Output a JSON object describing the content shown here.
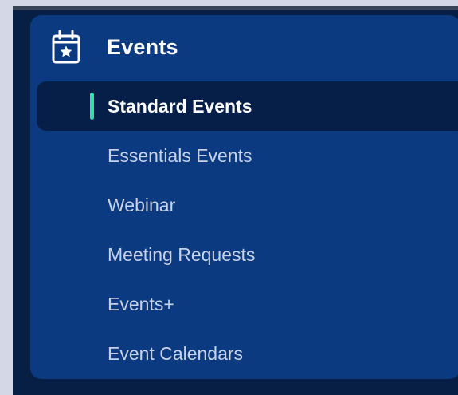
{
  "section": {
    "title": "Events",
    "icon": "calendar-star-icon"
  },
  "menu": {
    "items": [
      {
        "label": "Standard Events",
        "active": true
      },
      {
        "label": "Essentials Events",
        "active": false
      },
      {
        "label": "Webinar",
        "active": false
      },
      {
        "label": "Meeting Requests",
        "active": false
      },
      {
        "label": "Events+",
        "active": false
      },
      {
        "label": "Event Calendars",
        "active": false
      }
    ]
  },
  "colors": {
    "page_background": "#d3d7e6",
    "app_background": "#071f44",
    "panel_background": "#0b3a80",
    "active_item_background": "#051f48",
    "active_indicator": "#37dcae",
    "active_text": "#ffffff",
    "inactive_text": "#c7d2e6"
  }
}
